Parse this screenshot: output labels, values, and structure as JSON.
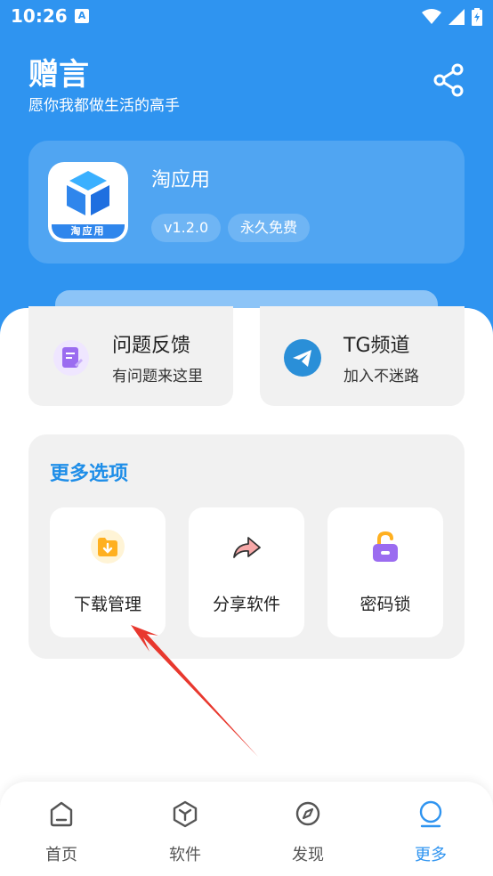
{
  "status_bar": {
    "time": "10:26",
    "notification_icon": "a-icon",
    "icons": [
      "wifi-icon",
      "signal-icon",
      "battery-charging-icon"
    ]
  },
  "header": {
    "title": "赠言",
    "subtitle": "愿你我都做生活的高手",
    "share_icon": "share-icon"
  },
  "app_card": {
    "logo_text": "淘应用",
    "name": "淘应用",
    "version": "v1.2.0",
    "price_badge": "永久免费"
  },
  "feature_cards": [
    {
      "title": "问题反馈",
      "subtitle": "有问题来这里",
      "icon": "feedback-icon",
      "color": "#9b6cf0"
    },
    {
      "title": "TG频道",
      "subtitle": "加入不迷路",
      "icon": "telegram-icon",
      "color": "#2a8fd8"
    }
  ],
  "more_options": {
    "heading": "更多选项",
    "items": [
      {
        "label": "下载管理",
        "icon": "download-folder-icon"
      },
      {
        "label": "分享软件",
        "icon": "share-arrow-icon"
      },
      {
        "label": "密码锁",
        "icon": "lock-icon"
      }
    ]
  },
  "bottom_nav": {
    "items": [
      {
        "label": "首页",
        "icon": "home-icon",
        "active": false
      },
      {
        "label": "软件",
        "icon": "software-icon",
        "active": false
      },
      {
        "label": "发现",
        "icon": "compass-icon",
        "active": false
      },
      {
        "label": "更多",
        "icon": "more-icon",
        "active": true
      }
    ]
  },
  "colors": {
    "brand_blue": "#2f94f0",
    "accent_text": "#1f8ee8",
    "annotation_arrow": "#e8382e"
  }
}
